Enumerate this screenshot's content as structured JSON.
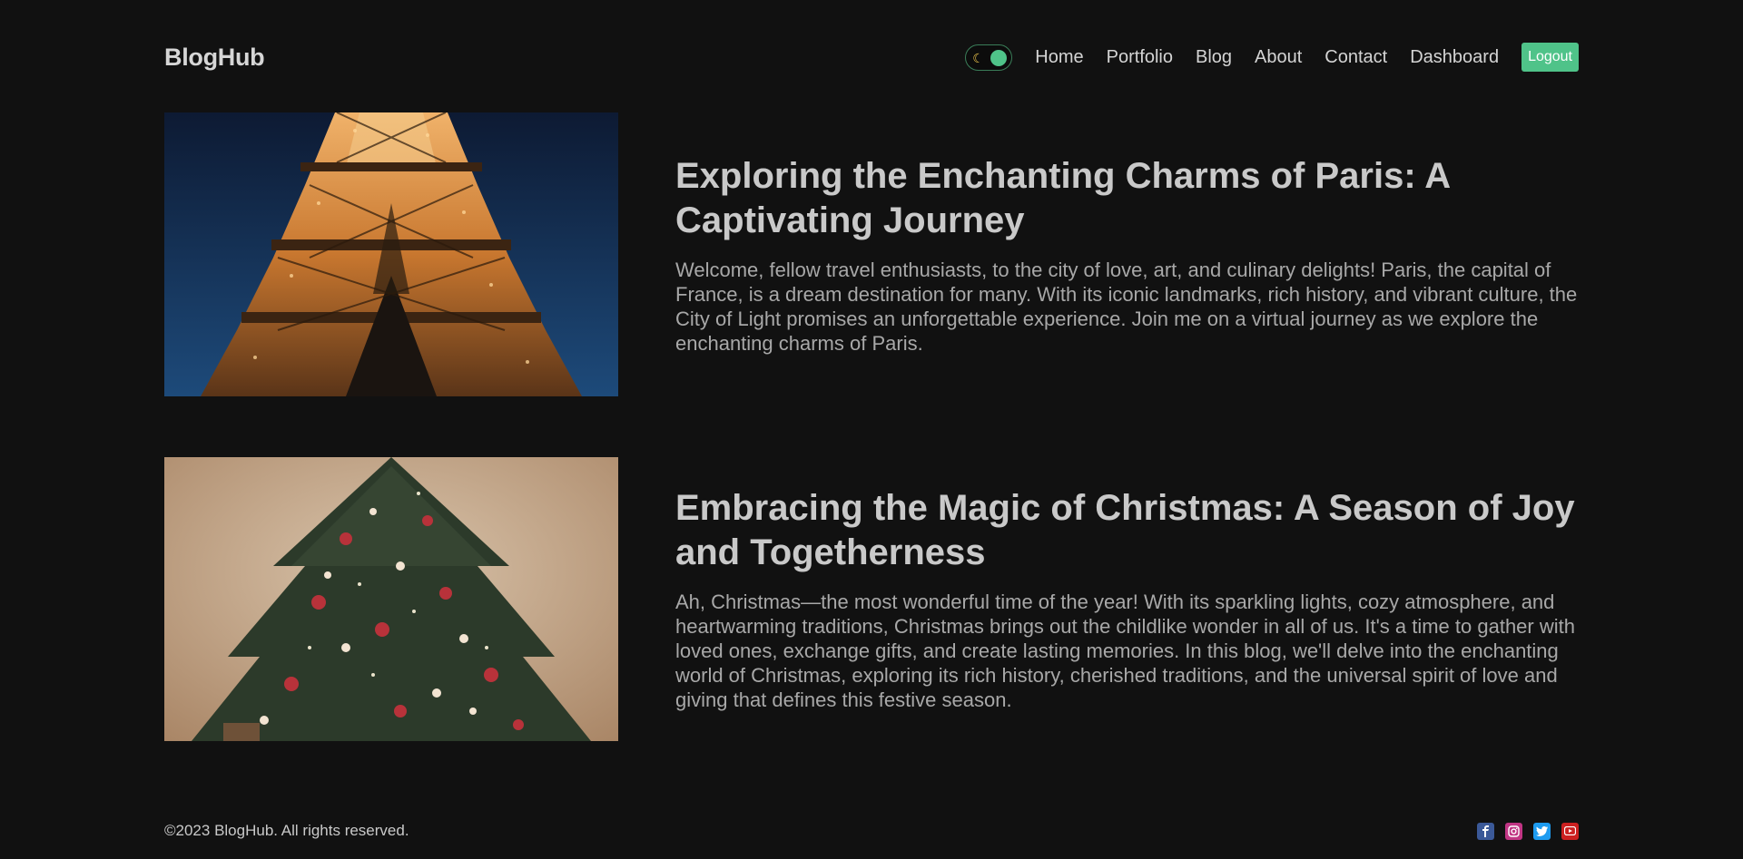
{
  "header": {
    "brand": "BlogHub",
    "theme_toggle_icon": "moon-icon",
    "nav": [
      "Home",
      "Portfolio",
      "Blog",
      "About",
      "Contact",
      "Dashboard"
    ],
    "logout_label": "Logout",
    "accent_color": "#4fc389"
  },
  "posts": [
    {
      "title": "Exploring the Enchanting Charms of Paris: A Captivating Journey",
      "excerpt": "Welcome, fellow travel enthusiasts, to the city of love, art, and culinary delights! Paris, the capital of France, is a dream destination for many. With its iconic landmarks, rich history, and vibrant culture, the City of Light promises an unforgettable experience. Join me on a virtual journey as we explore the enchanting charms of Paris."
    },
    {
      "title": "Embracing the Magic of Christmas: A Season of Joy and Togetherness",
      "excerpt": "Ah, Christmas—the most wonderful time of the year! With its sparkling lights, cozy atmosphere, and heartwarming traditions, Christmas brings out the childlike wonder in all of us. It's a time to gather with loved ones, exchange gifts, and create lasting memories. In this blog, we'll delve into the enchanting world of Christmas, exploring its rich history, cherished traditions, and the universal spirit of love and giving that defines this festive season."
    }
  ],
  "footer": {
    "copyright": "©2023 BlogHub. All rights reserved.",
    "socials": [
      {
        "name": "facebook-icon",
        "color": "#3b5998"
      },
      {
        "name": "instagram-icon",
        "color": "#c13584"
      },
      {
        "name": "twitter-icon",
        "color": "#1d9bf0"
      },
      {
        "name": "youtube-icon",
        "color": "#cc2020"
      }
    ]
  }
}
